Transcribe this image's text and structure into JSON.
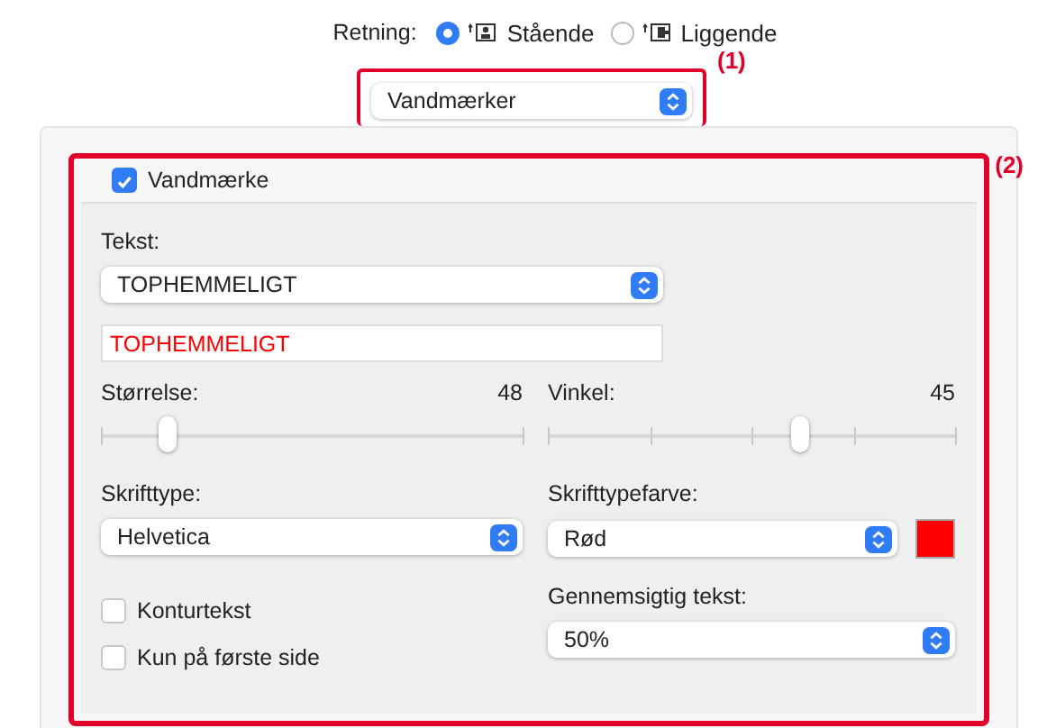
{
  "orientation": {
    "label": "Retning:",
    "options": [
      {
        "label": "Stående",
        "selected": true
      },
      {
        "label": "Liggende",
        "selected": false
      }
    ]
  },
  "mode_select": {
    "value": "Vandmærker",
    "callout": "(1)"
  },
  "watermark_panel": {
    "callout": "(2)",
    "enabled": {
      "label": "Vandmærke",
      "checked": true
    },
    "text_label": "Tekst:",
    "text_select": "TOPHEMMELIGT",
    "text_input": {
      "value": "TOPHEMMELIGT",
      "color": "#ff0000"
    },
    "sliders": [
      {
        "label": "Størrelse:",
        "reading": "48",
        "level": 0.16
      },
      {
        "label": "Vinkel:",
        "reading": "45",
        "level": 0.62
      }
    ],
    "font_label": "Skrifttype:",
    "font_select": "Helvetica",
    "color_label": "Skrifttypefarve:",
    "color_select": "Rød",
    "swatch": {
      "color": "#ff0000"
    },
    "checkboxes": [
      {
        "label": "Konturtekst",
        "checked": false
      },
      {
        "label": "Kun på første side",
        "checked": false
      }
    ],
    "transparency_label": "Gennemsigtig tekst:",
    "transparency_select": "50%"
  }
}
